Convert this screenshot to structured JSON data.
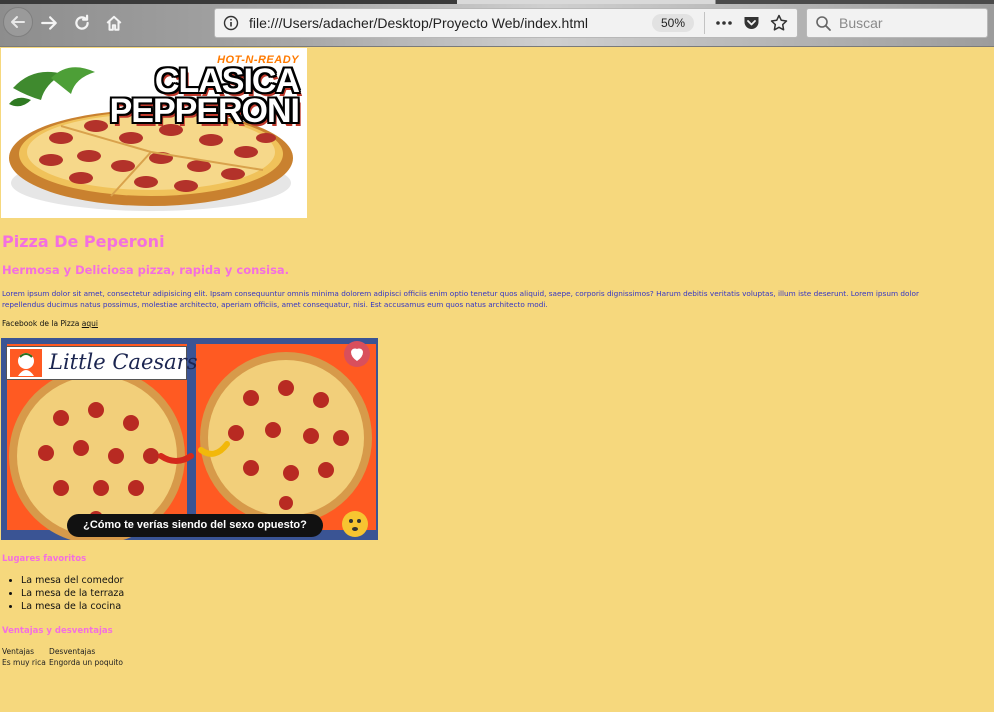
{
  "browser": {
    "url": "file:///Users/adacher/Desktop/Proyecto Web/index.html",
    "zoom": "50%",
    "search_placeholder": "Buscar"
  },
  "hero_image": {
    "badge": "HOT-N-READY",
    "line1": "CLASICA",
    "line2": "PEPPERONI"
  },
  "page": {
    "title": "Pizza De Peperoni",
    "subtitle": "Hermosa y Deliciosa pizza, rapida y consisa.",
    "lorem_line1": "Lorem ipsum dolor sit amet, consectetur adipisicing elit. Ipsam consequuntur omnis minima dolorem adipisci officiis enim optio tenetur quos aliquid, saepe, corporis dignissimos? Harum debitis veritatis voluptas, illum iste deserunt. Lorem ipsum dolor",
    "lorem_line2": "repellendus ducimus natus possimus, molestiae architecto, aperiam officiis, amet consequatur, nisi. Est accusamus eum quos natus architecto modi.",
    "facebook_text": "Facebook de la Pizza",
    "facebook_link": "aqui"
  },
  "promo_image": {
    "brand": "Little Caesars",
    "caption": "¿Cómo te verías siendo del sexo opuesto?"
  },
  "favorites": {
    "heading": "Lugares favoritos",
    "items": [
      "La mesa del comedor",
      "La mesa de la terraza",
      "La mesa de la cocina"
    ]
  },
  "pros_cons": {
    "heading": "Ventajas y desventajas",
    "col1": "Ventajas",
    "col2": "Desventajas",
    "row1_col1": "Es muy rica",
    "row1_col2": "Engorda un poquito"
  },
  "colors": {
    "background": "#f6d87d",
    "heading_pink": "#f36fe0",
    "lorem_blue": "#3535c4"
  }
}
